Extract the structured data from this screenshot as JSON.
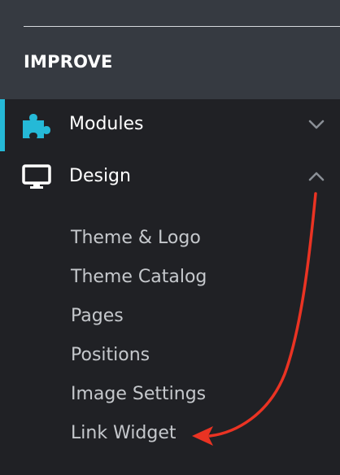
{
  "section": {
    "title": "IMPROVE"
  },
  "menu": [
    {
      "label": "Modules",
      "icon": "puzzle-icon",
      "state": "collapsed",
      "active": true
    },
    {
      "label": "Design",
      "icon": "monitor-icon",
      "state": "expanded",
      "active": false
    }
  ],
  "submenu": [
    {
      "label": "Theme & Logo"
    },
    {
      "label": "Theme Catalog"
    },
    {
      "label": "Pages"
    },
    {
      "label": "Positions"
    },
    {
      "label": "Image Settings"
    },
    {
      "label": "Link Widget"
    }
  ],
  "colors": {
    "background": "#202125",
    "header": "#363a41",
    "accent": "#25b9d7",
    "annotation_arrow": "#ea3323",
    "text": "#ffffff",
    "submenu_text": "#c5c8cc"
  }
}
